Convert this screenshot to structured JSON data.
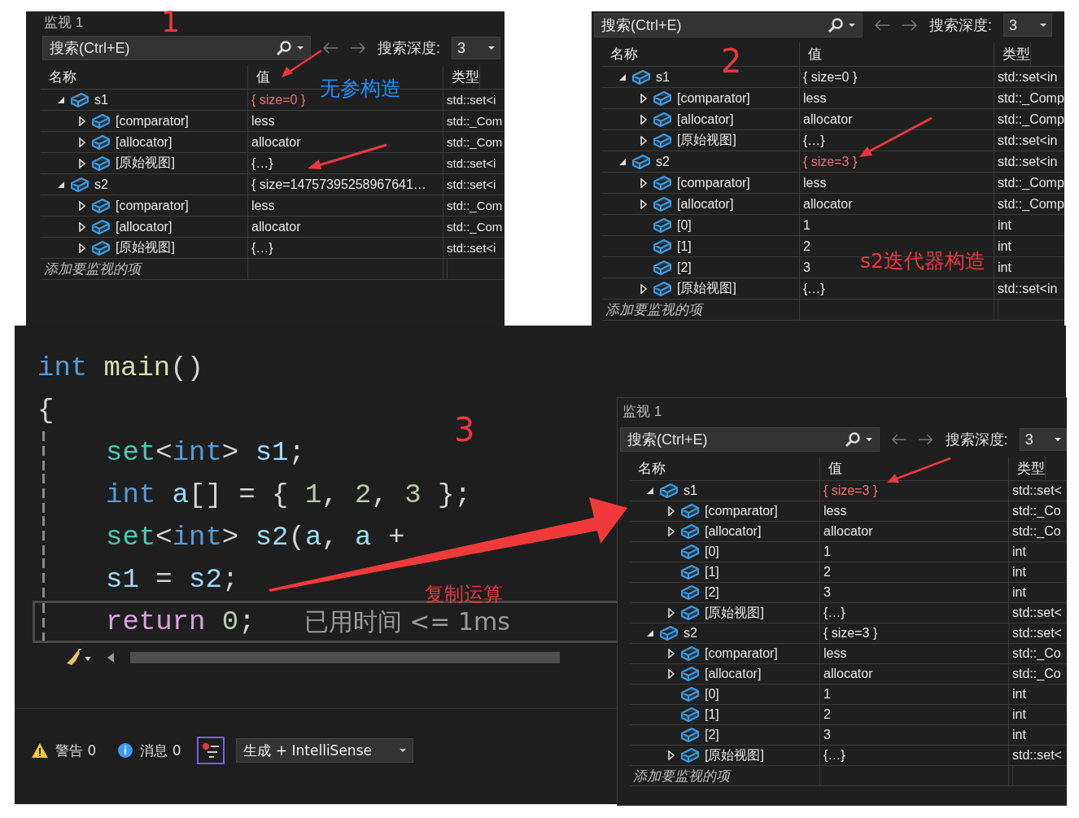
{
  "watches": [
    {
      "title": "监视 1",
      "search": {
        "placeholder": "搜索(Ctrl+E)"
      },
      "depth_label": "搜索深度:",
      "depth": "3",
      "columns": [
        "名称",
        "值",
        "类型"
      ],
      "add_row": "添加要监视的项",
      "rows": [
        {
          "name": "s1",
          "value": "{ size=0 }",
          "type": "std::set<i",
          "changed": true,
          "expanded": true,
          "children": [
            {
              "name": "[comparator]",
              "value": "less",
              "type": "std::_Com",
              "changed": false,
              "expanded": false
            },
            {
              "name": "[allocator]",
              "value": "allocator",
              "type": "std::_Com",
              "changed": false,
              "expanded": false
            },
            {
              "name": "[原始视图]",
              "value": "{…}",
              "type": "std::set<i",
              "changed": false,
              "expanded": false
            }
          ]
        },
        {
          "name": "s2",
          "value": "{ size=14757395258967641…",
          "type": "std::set<i",
          "changed": false,
          "expanded": true,
          "children": [
            {
              "name": "[comparator]",
              "value": "less",
              "type": "std::_Com",
              "changed": false,
              "expanded": false
            },
            {
              "name": "[allocator]",
              "value": "allocator",
              "type": "std::_Com",
              "changed": false,
              "expanded": false
            },
            {
              "name": "[原始视图]",
              "value": "{…}",
              "type": "std::set<i",
              "changed": false,
              "expanded": false
            }
          ]
        }
      ]
    },
    {
      "search": {
        "placeholder": "搜索(Ctrl+E)"
      },
      "depth_label": "搜索深度:",
      "depth": "3",
      "columns": [
        "名称",
        "值",
        "类型"
      ],
      "add_row": "添加要监视的项",
      "rows": [
        {
          "name": "s1",
          "value": "{ size=0 }",
          "type": "std::set<in",
          "changed": false,
          "expanded": true,
          "children": [
            {
              "name": "[comparator]",
              "value": "less",
              "type": "std::_Comp",
              "changed": false,
              "expanded": false
            },
            {
              "name": "[allocator]",
              "value": "allocator",
              "type": "std::_Comp",
              "changed": false,
              "expanded": false
            },
            {
              "name": "[原始视图]",
              "value": "{…}",
              "type": "std::set<in",
              "changed": false,
              "expanded": false
            }
          ]
        },
        {
          "name": "s2",
          "value": "{ size=3 }",
          "type": "std::set<in",
          "changed": true,
          "expanded": true,
          "children": [
            {
              "name": "[comparator]",
              "value": "less",
              "type": "std::_Comp",
              "changed": false,
              "expanded": false
            },
            {
              "name": "[allocator]",
              "value": "allocator",
              "type": "std::_Comp",
              "changed": false,
              "expanded": false
            },
            {
              "name": "[0]",
              "value": "1",
              "type": "int",
              "changed": false
            },
            {
              "name": "[1]",
              "value": "2",
              "type": "int",
              "changed": false
            },
            {
              "name": "[2]",
              "value": "3",
              "type": "int",
              "changed": false
            },
            {
              "name": "[原始视图]",
              "value": "{…}",
              "type": "std::set<in",
              "changed": false,
              "expanded": false
            }
          ]
        }
      ]
    },
    {
      "title": "监视 1",
      "search": {
        "placeholder": "搜索(Ctrl+E)"
      },
      "depth_label": "搜索深度:",
      "depth": "3",
      "columns": [
        "名称",
        "值",
        "类型"
      ],
      "add_row": "添加要监视的项",
      "rows": [
        {
          "name": "s1",
          "value": "{ size=3 }",
          "type": "std::set<",
          "changed": true,
          "expanded": true,
          "children": [
            {
              "name": "[comparator]",
              "value": "less",
              "type": "std::_Co",
              "changed": false,
              "expanded": false
            },
            {
              "name": "[allocator]",
              "value": "allocator",
              "type": "std::_Co",
              "changed": false,
              "expanded": false
            },
            {
              "name": "[0]",
              "value": "1",
              "type": "int",
              "changed": false
            },
            {
              "name": "[1]",
              "value": "2",
              "type": "int",
              "changed": false
            },
            {
              "name": "[2]",
              "value": "3",
              "type": "int",
              "changed": false
            },
            {
              "name": "[原始视图]",
              "value": "{…}",
              "type": "std::set<",
              "changed": false,
              "expanded": false
            }
          ]
        },
        {
          "name": "s2",
          "value": "{ size=3 }",
          "type": "std::set<",
          "changed": false,
          "expanded": true,
          "children": [
            {
              "name": "[comparator]",
              "value": "less",
              "type": "std::_Co",
              "changed": false,
              "expanded": false
            },
            {
              "name": "[allocator]",
              "value": "allocator",
              "type": "std::_Co",
              "changed": false,
              "expanded": false
            },
            {
              "name": "[0]",
              "value": "1",
              "type": "int",
              "changed": false
            },
            {
              "name": "[1]",
              "value": "2",
              "type": "int",
              "changed": false
            },
            {
              "name": "[2]",
              "value": "3",
              "type": "int",
              "changed": false
            },
            {
              "name": "[原始视图]",
              "value": "{…}",
              "type": "std::set<",
              "changed": false,
              "expanded": false
            }
          ]
        }
      ]
    }
  ],
  "editor": {
    "lines": [
      {
        "indented": false,
        "current": false,
        "tokens": [
          {
            "text": "int",
            "kind": "keyword"
          },
          {
            "text": " main",
            "kind": "function"
          },
          {
            "text": "()",
            "kind": "punct"
          }
        ]
      },
      {
        "indented": false,
        "current": false,
        "tokens": [
          {
            "text": "{",
            "kind": "punct"
          }
        ]
      },
      {
        "indented": true,
        "current": false,
        "tokens": [
          {
            "text": "set",
            "kind": "type"
          },
          {
            "text": "<",
            "kind": "punct"
          },
          {
            "text": "int",
            "kind": "keyword"
          },
          {
            "text": "> ",
            "kind": "punct"
          },
          {
            "text": "s1",
            "kind": "variable"
          },
          {
            "text": ";",
            "kind": "punct"
          }
        ]
      },
      {
        "indented": true,
        "current": false,
        "tokens": [
          {
            "text": "int",
            "kind": "keyword"
          },
          {
            "text": " a",
            "kind": "variable"
          },
          {
            "text": "[] = { ",
            "kind": "punct"
          },
          {
            "text": "1",
            "kind": "number"
          },
          {
            "text": ", ",
            "kind": "punct"
          },
          {
            "text": "2",
            "kind": "number"
          },
          {
            "text": ", ",
            "kind": "punct"
          },
          {
            "text": "3",
            "kind": "number"
          },
          {
            "text": " };",
            "kind": "punct"
          }
        ]
      },
      {
        "indented": true,
        "current": false,
        "tokens": [
          {
            "text": "set",
            "kind": "type"
          },
          {
            "text": "<",
            "kind": "punct"
          },
          {
            "text": "int",
            "kind": "keyword"
          },
          {
            "text": "> ",
            "kind": "punct"
          },
          {
            "text": "s2",
            "kind": "variable"
          },
          {
            "text": "(",
            "kind": "punct"
          },
          {
            "text": "a",
            "kind": "variable"
          },
          {
            "text": ", ",
            "kind": "punct"
          },
          {
            "text": "a",
            "kind": "variable"
          },
          {
            "text": " +",
            "kind": "punct"
          }
        ]
      },
      {
        "indented": true,
        "current": false,
        "tokens": [
          {
            "text": "s1",
            "kind": "variable"
          },
          {
            "text": " = ",
            "kind": "punct"
          },
          {
            "text": "s2",
            "kind": "variable"
          },
          {
            "text": ";",
            "kind": "punct"
          }
        ]
      },
      {
        "indented": true,
        "current": true,
        "hint": "已用时间 <= 1ms",
        "tokens": [
          {
            "text": "return",
            "kind": "control"
          },
          {
            "text": " 0",
            "kind": "number"
          },
          {
            "text": ";",
            "kind": "punct"
          }
        ]
      }
    ]
  },
  "error_list": {
    "warnings": "警告 0",
    "messages": "消息 0",
    "source": "生成 + IntelliSense"
  },
  "annotations": [
    {
      "text": "1",
      "color": "#e8383d"
    },
    {
      "text": "无参构造",
      "color": "#1e90ff"
    },
    {
      "text": "2",
      "color": "#e8383d"
    },
    {
      "text": "s2迭代器构造",
      "color": "#e8383d"
    },
    {
      "text": "3",
      "color": "#e8383d"
    },
    {
      "text": "复制运算",
      "color": "#e8383d"
    }
  ]
}
